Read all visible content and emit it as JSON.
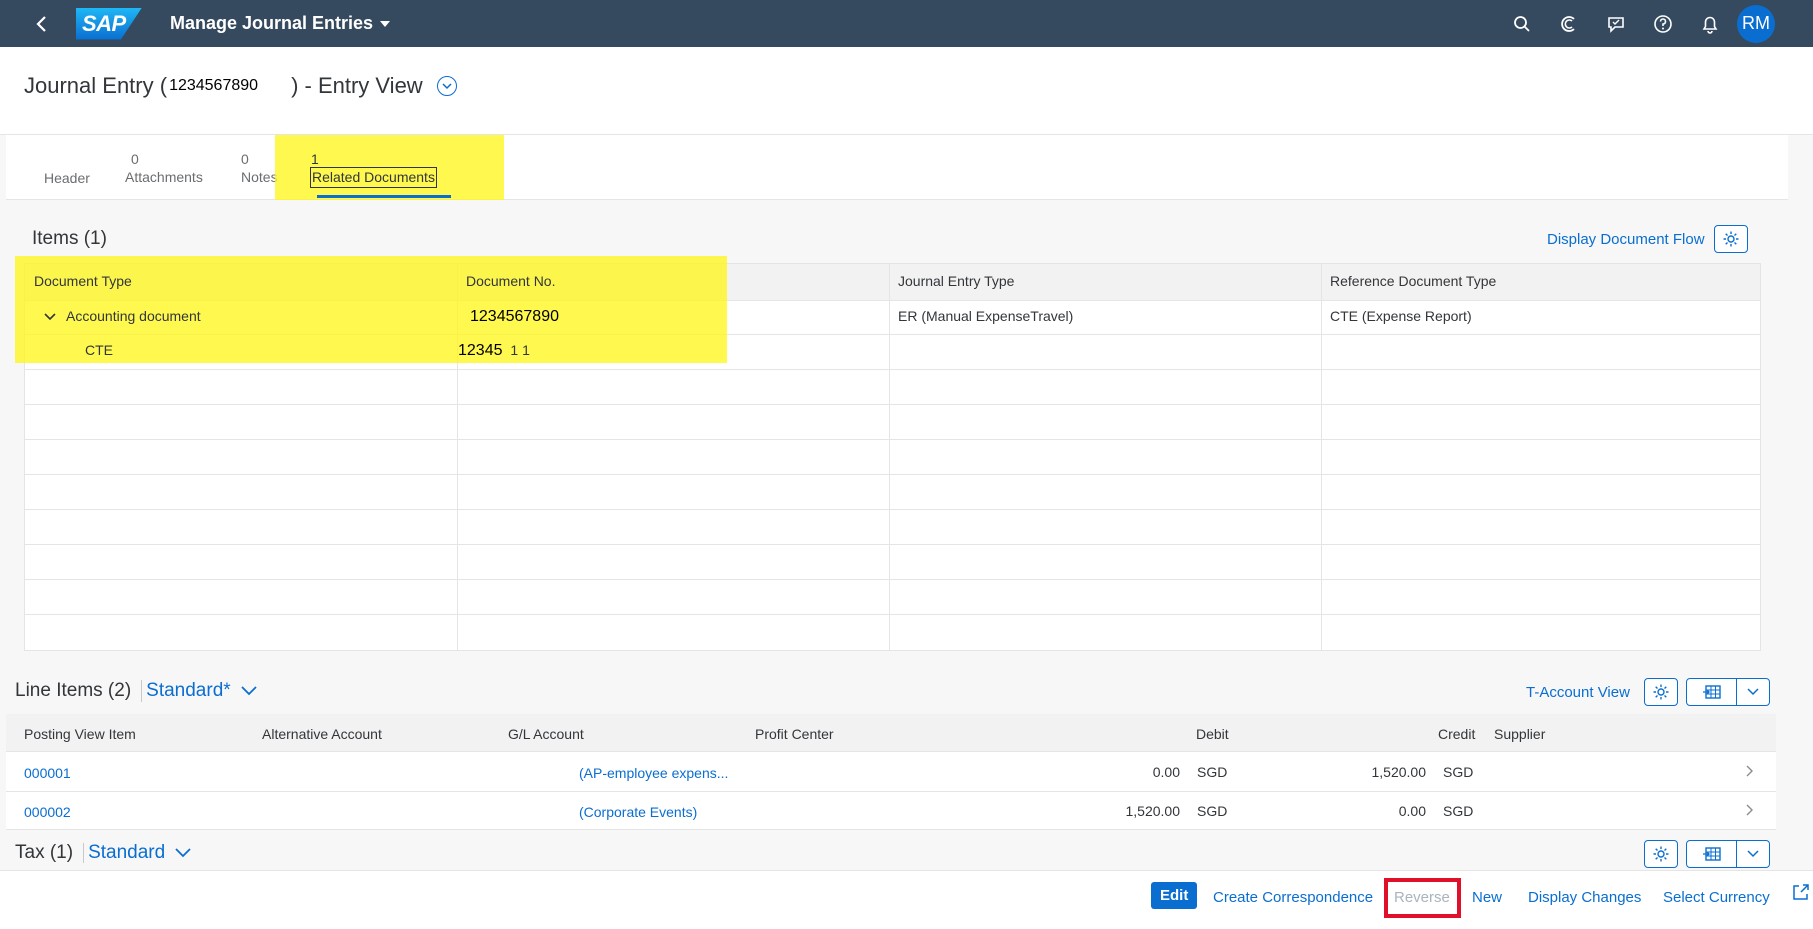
{
  "shell": {
    "app_title": "Manage Journal Entries",
    "logo_text": "SAP",
    "user_initials": "RM",
    "icons": [
      "back-icon",
      "search-icon",
      "copilot-icon",
      "feedback-icon",
      "help-icon",
      "notifications-icon"
    ]
  },
  "page": {
    "title_prefix": "Journal Entry (",
    "doc_number": "1234567890",
    "title_suffix": ") - Entry View"
  },
  "tabs": [
    {
      "count": "",
      "label": "Header"
    },
    {
      "count": "0",
      "label": "Attachments"
    },
    {
      "count": "0",
      "label": "Notes"
    },
    {
      "count": "1",
      "label": "Related Documents",
      "active": true
    }
  ],
  "items": {
    "title": "Items (1)",
    "display_flow_label": "Display Document Flow",
    "columns": [
      "Document Type",
      "Document No.",
      "Journal Entry Type",
      "Reference Document Type"
    ],
    "rows": [
      {
        "doc_type": "Accounting document",
        "doc_no": "1234567890",
        "je_type": "ER (Manual ExpenseTravel)",
        "ref_type": "CTE (Expense Report)"
      },
      {
        "doc_type": "CTE",
        "doc_no": "12345",
        "doc_no_suffix": "1 1",
        "je_type": "",
        "ref_type": ""
      }
    ]
  },
  "line_items": {
    "title": "Line Items (2)",
    "variant": "Standard*",
    "taccount_label": "T-Account View",
    "columns": [
      "Posting View Item",
      "Alternative Account",
      "G/L Account",
      "Profit Center",
      "Debit",
      "Credit",
      "Supplier"
    ],
    "rows": [
      {
        "item": "000001",
        "alt_account": "",
        "gl_account": "(AP-employee expens...",
        "profit_center": "",
        "debit": "0.00",
        "debit_cur": "SGD",
        "credit": "1,520.00",
        "credit_cur": "SGD",
        "supplier": ""
      },
      {
        "item": "000002",
        "alt_account": "",
        "gl_account": "(Corporate Events)",
        "profit_center": "",
        "debit": "1,520.00",
        "debit_cur": "SGD",
        "credit": "0.00",
        "credit_cur": "SGD",
        "supplier": ""
      }
    ]
  },
  "tax": {
    "title": "Tax (1)",
    "variant": "Standard"
  },
  "footer": {
    "edit": "Edit",
    "create_correspondence": "Create Correspondence",
    "reverse": "Reverse",
    "new": "New",
    "display_changes": "Display Changes",
    "select_currency": "Select Currency"
  },
  "colors": {
    "shell": "#354a5f",
    "accent": "#0a6ed1",
    "highlight": "#fff71e",
    "annotation_red": "#e0102a"
  }
}
